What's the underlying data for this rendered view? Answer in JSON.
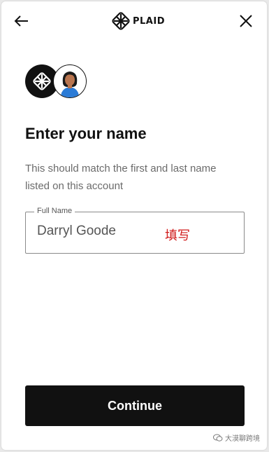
{
  "header": {
    "brand_text": "PLAID"
  },
  "content": {
    "title": "Enter your name",
    "subtitle": "This should match the first and last name listed on this account"
  },
  "name_field": {
    "label": "Full Name",
    "value": "Darryl Goode"
  },
  "annotation": "填写",
  "actions": {
    "continue_label": "Continue"
  },
  "watermark": "大漠聊跨境",
  "colors": {
    "primary": "#111111",
    "subtitle_text": "#6b6b6b",
    "annotation": "#d01a1a",
    "avatar_accent": "#2b7bd6"
  },
  "icons": {
    "back": "arrow-left-icon",
    "close": "close-icon",
    "brand": "plaid-logo-icon",
    "user": "user-avatar-icon"
  }
}
